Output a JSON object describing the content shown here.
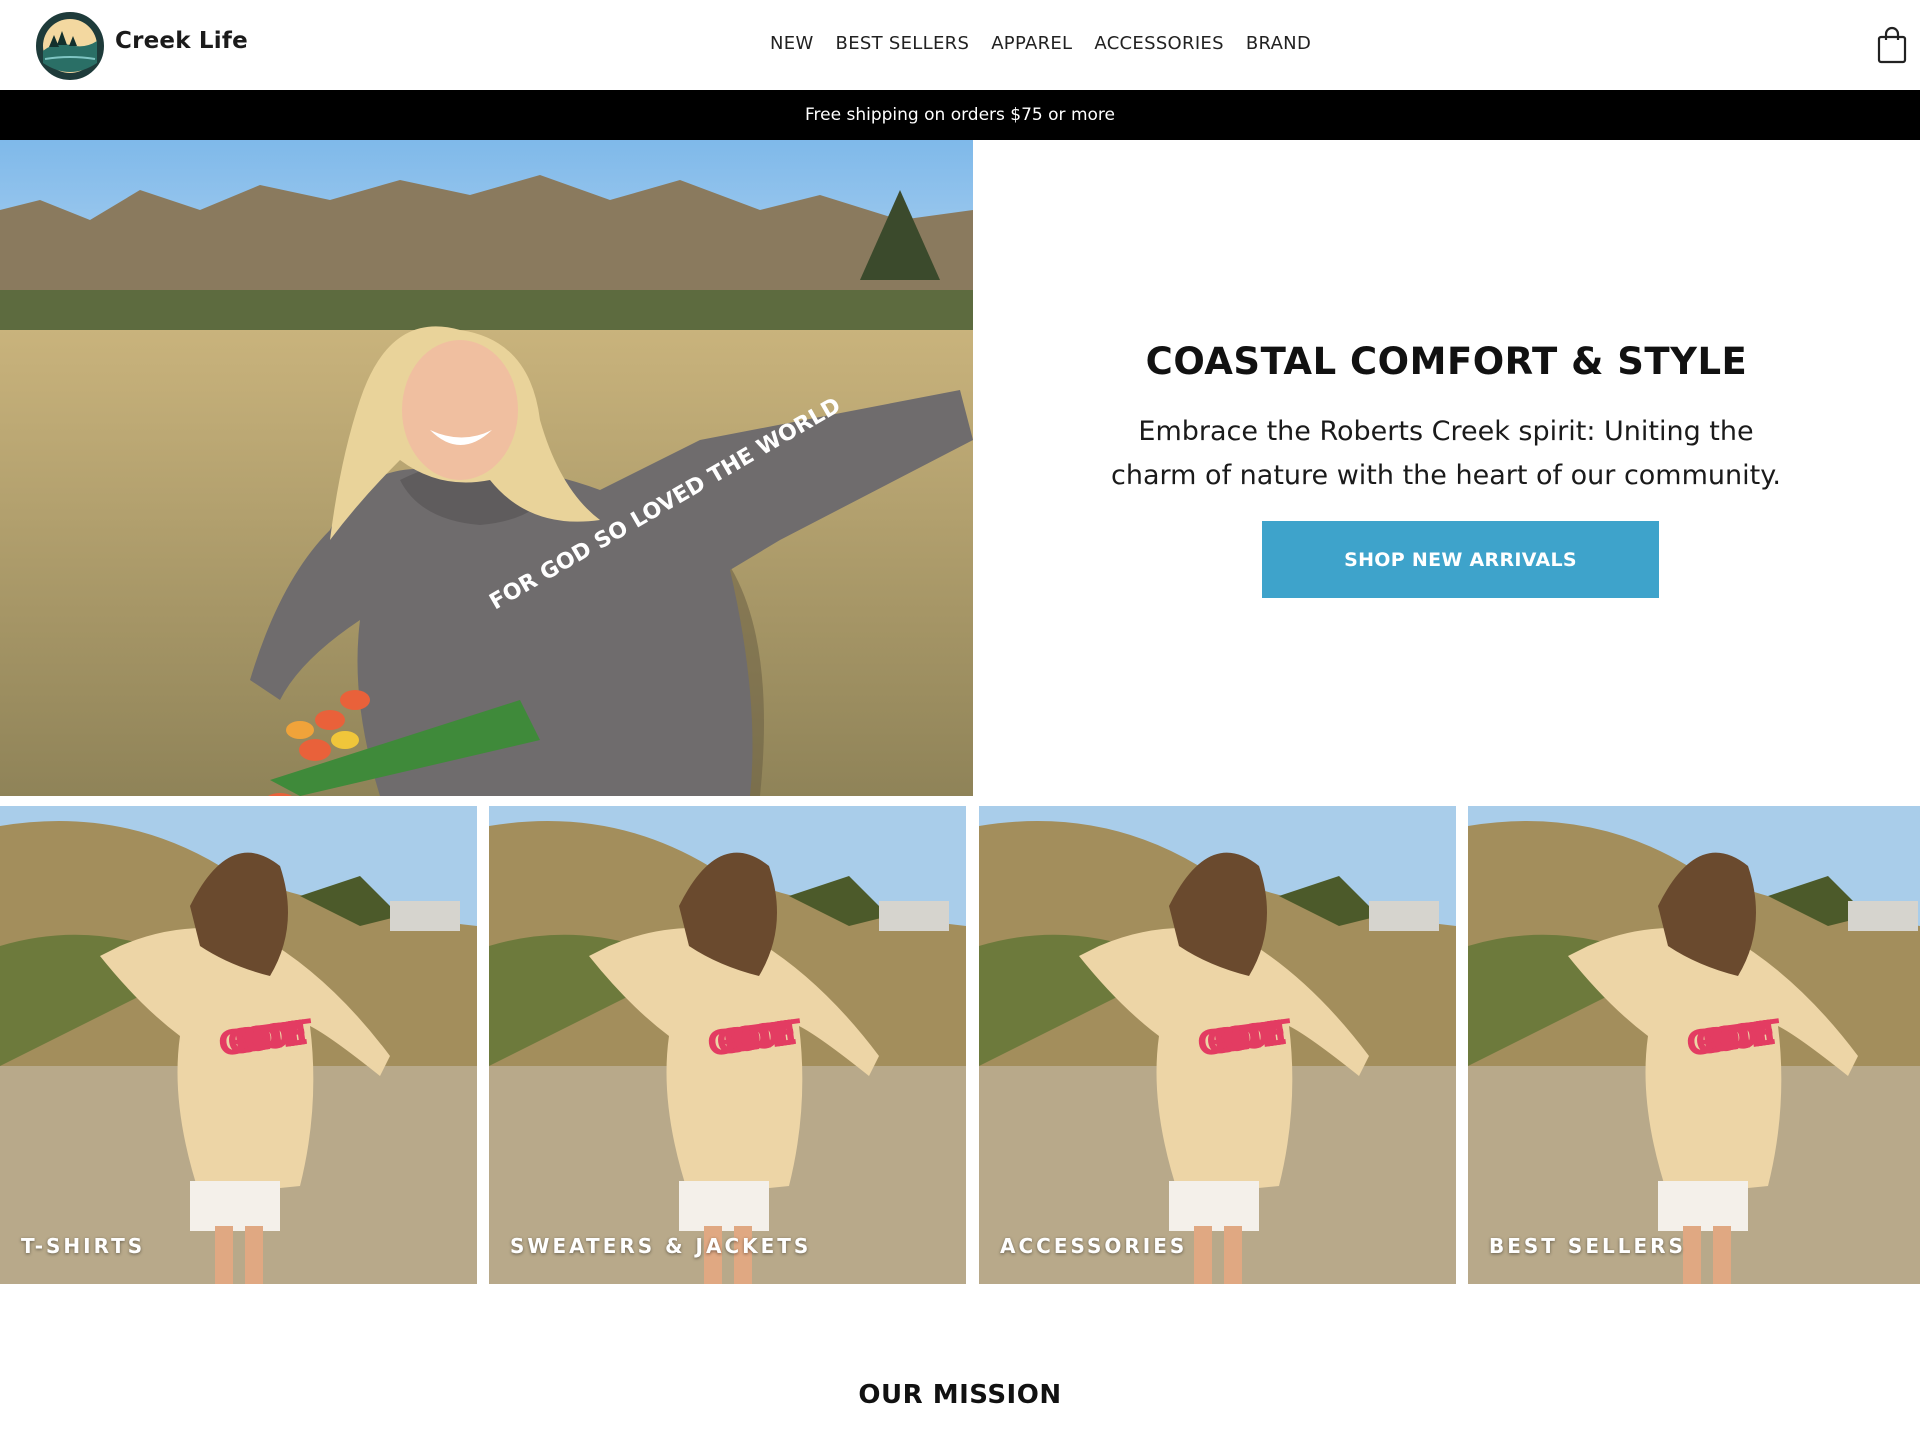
{
  "header": {
    "brand": "Creek Life",
    "logo_icon": "creek-life-logo",
    "cart_icon": "shopping-bag-icon",
    "nav": [
      "NEW",
      "BEST SELLERS",
      "APPAREL",
      "ACCESSORIES",
      "BRAND"
    ]
  },
  "announcement": "Free shipping on orders $75 or more",
  "hero": {
    "title": "COASTAL COMFORT & STYLE",
    "subtitle": "Embrace the Roberts Creek spirit: Uniting the charm of nature with the heart of our community.",
    "cta": "SHOP NEW ARRIVALS",
    "hoodie_print": "FOR GOD SO LOVED THE WORLD",
    "accent": "#3ea3cb"
  },
  "collections": [
    {
      "label": "T-SHIRTS"
    },
    {
      "label": "SWEATERS & JACKETS"
    },
    {
      "label": "ACCESSORIES"
    },
    {
      "label": "BEST SELLERS"
    }
  ],
  "collection_print": "GOD IS NOT DONE YET",
  "mission": {
    "title": "OUR MISSION"
  }
}
